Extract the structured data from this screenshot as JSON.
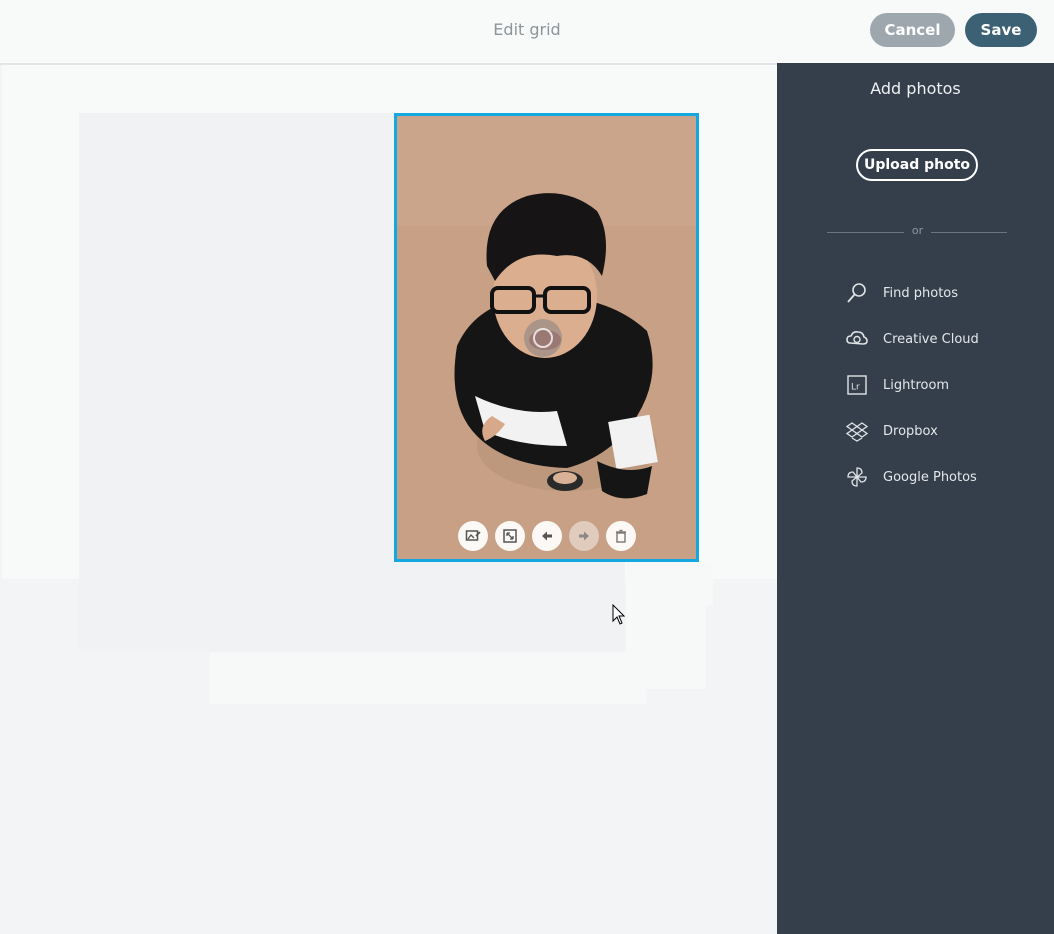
{
  "header": {
    "title": "Edit grid",
    "cancel_label": "Cancel",
    "save_label": "Save"
  },
  "sidebar": {
    "heading": "Add photos",
    "upload_label": "Upload photo",
    "or_label": "or",
    "sources": [
      {
        "label": "Find photos",
        "icon": "search-icon"
      },
      {
        "label": "Creative Cloud",
        "icon": "creative-cloud-icon"
      },
      {
        "label": "Lightroom",
        "icon": "lightroom-icon"
      },
      {
        "label": "Dropbox",
        "icon": "dropbox-icon"
      },
      {
        "label": "Google Photos",
        "icon": "google-photos-icon"
      }
    ]
  },
  "photo_toolbar": [
    {
      "icon": "replace-image-icon"
    },
    {
      "icon": "fit-image-icon"
    },
    {
      "icon": "arrow-left-icon"
    },
    {
      "icon": "arrow-right-icon"
    },
    {
      "icon": "trash-icon"
    }
  ],
  "colors": {
    "accent": "#14a8e0",
    "sidebar": "#343f4b",
    "save": "#3c6175",
    "cancel": "#9ea7ae"
  }
}
